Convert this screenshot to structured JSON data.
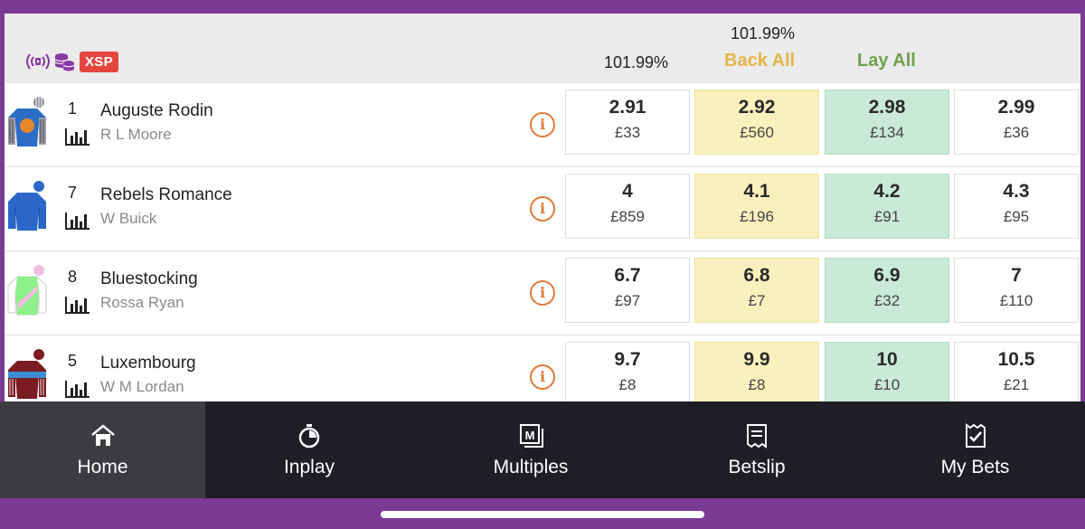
{
  "header": {
    "xsp_label": "XSP",
    "back_book_pct": "101.99%",
    "lay_book_pct": "101.99%",
    "back_all_label": "Back All",
    "lay_all_label": "Lay All",
    "icons": [
      "live-stream-icon",
      "coins-icon"
    ]
  },
  "runners": [
    {
      "number": "1",
      "name": "Auguste Rodin",
      "jockey": "R L Moore",
      "silk_colors": [
        "#2b6cc4",
        "#e8862a",
        "#8a8a9a"
      ],
      "prices": [
        {
          "odds": "2.91",
          "amount": "£33"
        },
        {
          "odds": "2.92",
          "amount": "£560"
        },
        {
          "odds": "2.98",
          "amount": "£134"
        },
        {
          "odds": "2.99",
          "amount": "£36"
        }
      ]
    },
    {
      "number": "7",
      "name": "Rebels Romance",
      "jockey": "W Buick",
      "silk_colors": [
        "#2a67c9",
        "#2a67c9",
        "#2a67c9"
      ],
      "prices": [
        {
          "odds": "4",
          "amount": "£859"
        },
        {
          "odds": "4.1",
          "amount": "£196"
        },
        {
          "odds": "4.2",
          "amount": "£91"
        },
        {
          "odds": "4.3",
          "amount": "£95"
        }
      ]
    },
    {
      "number": "8",
      "name": "Bluestocking",
      "jockey": "Rossa Ryan",
      "silk_colors": [
        "#8ef08a",
        "#f3bde2",
        "#ffffff"
      ],
      "prices": [
        {
          "odds": "6.7",
          "amount": "£97"
        },
        {
          "odds": "6.8",
          "amount": "£7"
        },
        {
          "odds": "6.9",
          "amount": "£32"
        },
        {
          "odds": "7",
          "amount": "£110"
        }
      ]
    },
    {
      "number": "5",
      "name": "Luxembourg",
      "jockey": "W M Lordan",
      "silk_colors": [
        "#7a1c22",
        "#3b8ed6",
        "#7a1c22"
      ],
      "prices": [
        {
          "odds": "9.7",
          "amount": "£8"
        },
        {
          "odds": "9.9",
          "amount": "£8"
        },
        {
          "odds": "10",
          "amount": "£10"
        },
        {
          "odds": "10.5",
          "amount": "£21"
        }
      ]
    }
  ],
  "nav": {
    "items": [
      {
        "label": "Home",
        "icon": "home-icon",
        "active": true
      },
      {
        "label": "Inplay",
        "icon": "stopwatch-icon",
        "active": false
      },
      {
        "label": "Multiples",
        "icon": "multiples-icon",
        "active": false
      },
      {
        "label": "Betslip",
        "icon": "betslip-icon",
        "active": false
      },
      {
        "label": "My Bets",
        "icon": "my-bets-icon",
        "active": false
      }
    ]
  },
  "colors": {
    "brand_purple": "#7b3a93",
    "back_highlight": "#faf0bd",
    "lay_highlight": "#c8ead6",
    "back_all_text": "#e5b548",
    "lay_all_text": "#6ea04c",
    "xsp_badge": "#e5453f"
  }
}
